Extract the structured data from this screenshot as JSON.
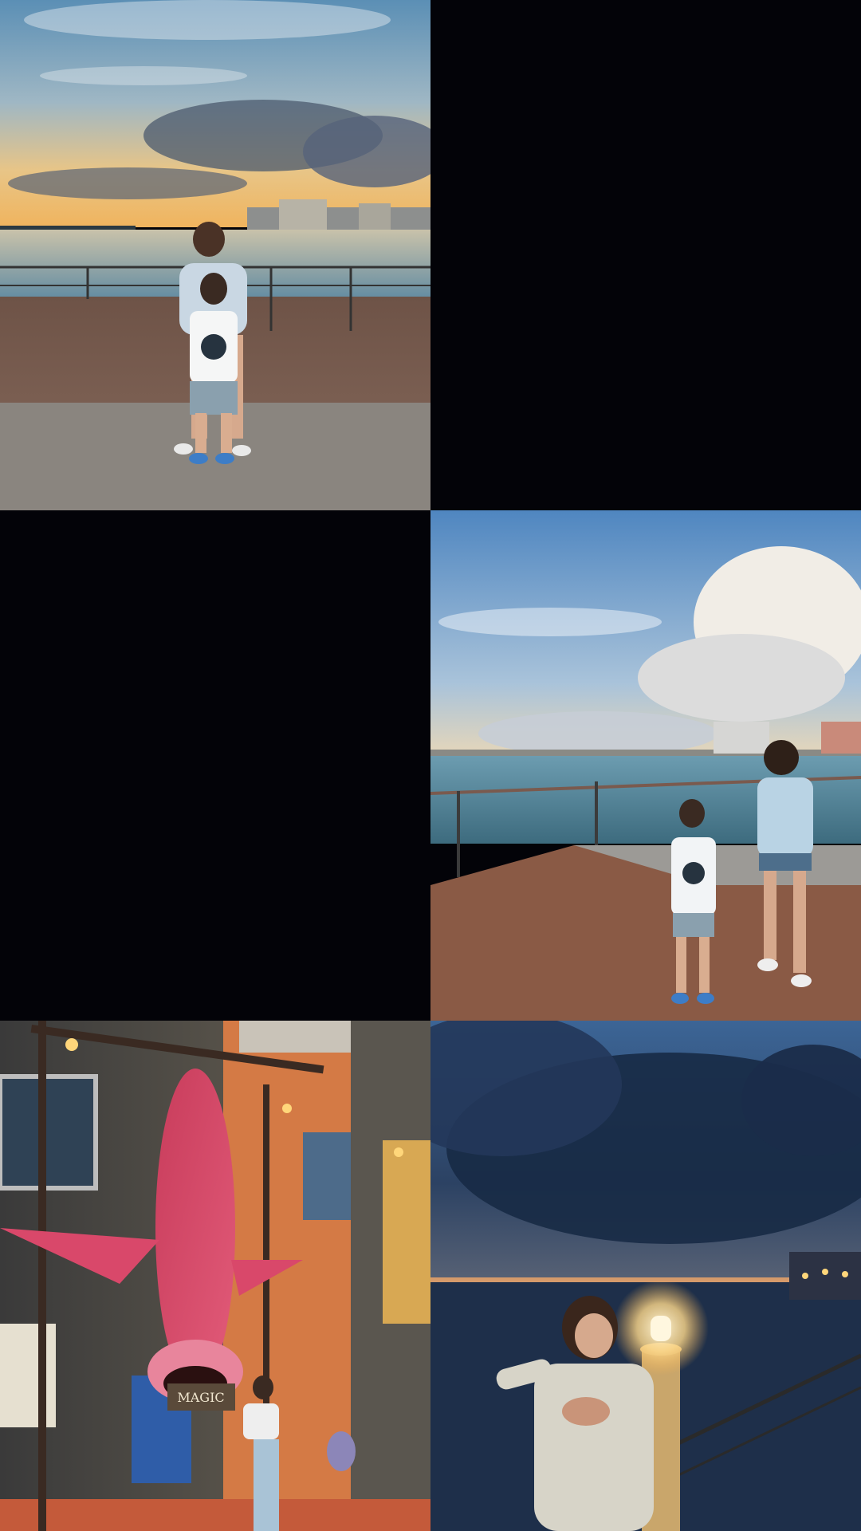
{
  "gallery": {
    "photos": [
      {
        "scene": "sunset-seaside-boardwalk"
      },
      {
        "scene": "empty"
      },
      {
        "scene": "empty"
      },
      {
        "scene": "daytime-seaside-boardwalk"
      },
      {
        "scene": "shark-storefront"
      },
      {
        "scene": "dusk-seaside-lamp"
      }
    ],
    "shark_sign": {
      "text": "MAGIC"
    },
    "colors": {
      "background": "#030308",
      "shark": "#d9486a",
      "deck": "#8a5a45",
      "sea_day": "#5a8fa8",
      "sea_dusk": "#1e2f4a",
      "lamp": "#ffe9a8"
    }
  }
}
